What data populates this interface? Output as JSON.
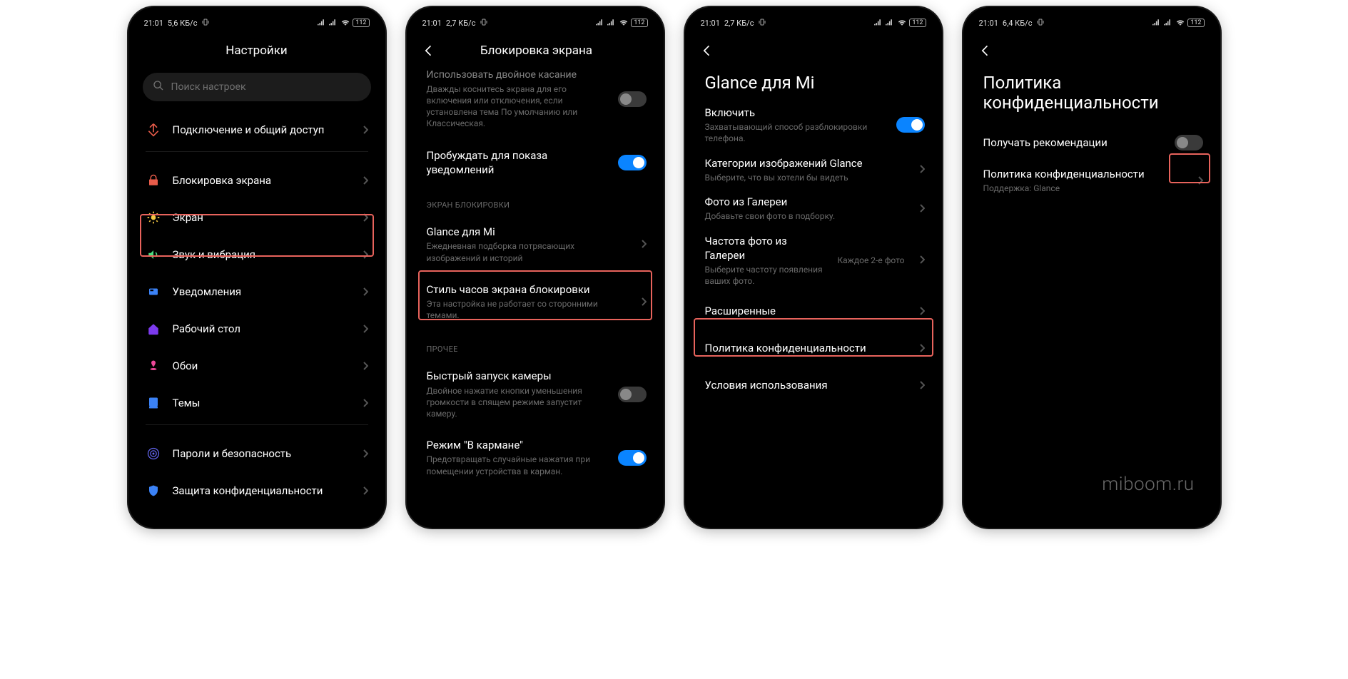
{
  "status": {
    "time": "21:01",
    "speed1": "5,6 КБ/с",
    "speed2": "2,7 КБ/с",
    "speed3": "2,7 КБ/с",
    "speed4": "6,4 КБ/с",
    "battery": "112"
  },
  "phone1": {
    "title": "Настройки",
    "search_placeholder": "Поиск настроек",
    "items": [
      {
        "label": "Подключение и общий доступ"
      },
      {
        "label": "Блокировка экрана"
      },
      {
        "label": "Экран"
      },
      {
        "label": "Звук и вибрация"
      },
      {
        "label": "Уведомления"
      },
      {
        "label": "Рабочий стол"
      },
      {
        "label": "Обои"
      },
      {
        "label": "Темы"
      },
      {
        "label": "Пароли и безопасность"
      },
      {
        "label": "Защита конфиденциальности"
      }
    ]
  },
  "phone2": {
    "title": "Блокировка экрана",
    "items": [
      {
        "title": "Использовать двойное касание",
        "sub": "Дважды коснитесь экрана для его включения или отключения, если установлена тема По умолчанию или Классическая."
      },
      {
        "title": "Пробуждать для показа уведомлений"
      }
    ],
    "section1": "ЭКРАН БЛОКИРОВКИ",
    "section1_items": [
      {
        "title": "Glance для Mi",
        "sub": "Ежедневная подборка потрясающих изображений и историй"
      },
      {
        "title": "Стиль часов экрана блокировки",
        "sub": "Эта настройка не работает со сторонними темами."
      }
    ],
    "section2": "ПРОЧЕЕ",
    "section2_items": [
      {
        "title": "Быстрый запуск камеры",
        "sub": "Двойное нажатие кнопки уменьшения громкости в спящем режиме запустит камеру."
      },
      {
        "title": "Режим \"В кармане\"",
        "sub": "Предотвращать случайные нажатия при помещении устройства в карман."
      }
    ]
  },
  "phone3": {
    "title": "Glance для Mi",
    "items": [
      {
        "title": "Включить",
        "sub": "Захватывающий способ разблокировки телефона."
      },
      {
        "title": "Категории изображений Glance",
        "sub": "Выберите, что вы хотели бы видеть"
      },
      {
        "title": "Фото из Галереи",
        "sub": "Добавьте свои фото в подборку."
      },
      {
        "title": "Частота фото из Галереи",
        "sub": "Выберите частоту появления ваших фото.",
        "value": "Каждое 2-е фото"
      },
      {
        "title": "Расширенные"
      },
      {
        "title": "Политика конфиденциальности"
      },
      {
        "title": "Условия использования"
      }
    ]
  },
  "phone4": {
    "title": "Политика конфиденциальности",
    "items": [
      {
        "title": "Получать рекомендации"
      },
      {
        "title": "Политика конфиденциальности",
        "sub": "Поддержка: Glance"
      }
    ]
  },
  "watermark": "miboom.ru"
}
